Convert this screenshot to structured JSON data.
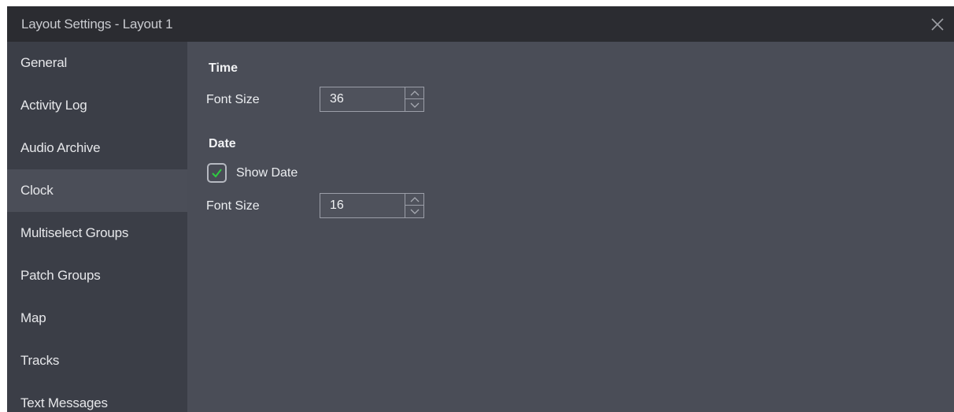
{
  "window": {
    "title": "Layout Settings - Layout 1"
  },
  "icons": {
    "close": "close-icon",
    "spin_up": "chevron-up-icon",
    "spin_down": "chevron-down-icon",
    "checkmark": "checkmark-icon"
  },
  "colors": {
    "checkmark": "#2ecc40",
    "titlebar": "#2b2c31",
    "sidebar": "#3b3e47",
    "sidebar_active": "#4b4e58",
    "content": "#4a4d57"
  },
  "sidebar": {
    "items": [
      {
        "label": "General"
      },
      {
        "label": "Activity Log"
      },
      {
        "label": "Audio Archive"
      },
      {
        "label": "Clock",
        "active": true
      },
      {
        "label": "Multiselect Groups"
      },
      {
        "label": "Patch Groups"
      },
      {
        "label": "Map"
      },
      {
        "label": "Tracks"
      },
      {
        "label": "Text Messages"
      }
    ]
  },
  "clock_settings": {
    "time": {
      "section_title": "Time",
      "font_size_label": "Font Size",
      "font_size_value": "36"
    },
    "date": {
      "section_title": "Date",
      "show_date_label": "Show Date",
      "show_date_checked": true,
      "font_size_label": "Font Size",
      "font_size_value": "16"
    }
  }
}
